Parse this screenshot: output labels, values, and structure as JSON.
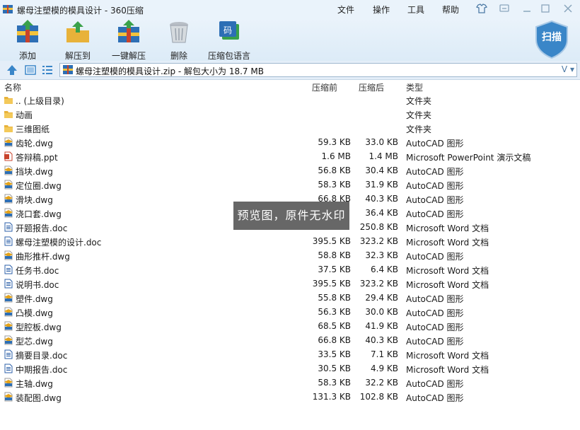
{
  "window": {
    "title": "螺母注塑模的模具设计 - 360压缩",
    "menus": [
      "文件",
      "操作",
      "工具",
      "帮助"
    ]
  },
  "toolbar": {
    "buttons": [
      {
        "label": "添加",
        "icon": "add-archive-icon"
      },
      {
        "label": "解压到",
        "icon": "extract-to-folder-icon"
      },
      {
        "label": "一键解压",
        "icon": "one-click-extract-icon"
      },
      {
        "label": "删除",
        "icon": "trash-can-icon"
      },
      {
        "label": "压缩包语言",
        "icon": "archive-language-icon"
      }
    ],
    "language_badge": "码",
    "scan_label": "扫描"
  },
  "address": {
    "path": "螺母注塑模的模具设计.zip - 解包大小为 18.7 MB",
    "dropdown_label": "V"
  },
  "columns": {
    "name": "名称",
    "size": "压缩前",
    "compressed": "压缩后",
    "type": "类型"
  },
  "files": [
    {
      "name": ".. (上级目录)",
      "size": "",
      "compressed": "",
      "type": "文件夹",
      "icon": "folder-icon"
    },
    {
      "name": "动画",
      "size": "",
      "compressed": "",
      "type": "文件夹",
      "icon": "folder-icon"
    },
    {
      "name": "三维图纸",
      "size": "",
      "compressed": "",
      "type": "文件夹",
      "icon": "folder-icon"
    },
    {
      "name": "齿轮.dwg",
      "size": "59.3 KB",
      "compressed": "33.0 KB",
      "type": "AutoCAD 图形",
      "icon": "dwg-file-icon"
    },
    {
      "name": "答辩稿.ppt",
      "size": "1.6 MB",
      "compressed": "1.4 MB",
      "type": "Microsoft PowerPoint 演示文稿",
      "icon": "ppt-file-icon"
    },
    {
      "name": "挡块.dwg",
      "size": "56.8 KB",
      "compressed": "30.4 KB",
      "type": "AutoCAD 图形",
      "icon": "dwg-file-icon"
    },
    {
      "name": "定位圈.dwg",
      "size": "58.3 KB",
      "compressed": "31.9 KB",
      "type": "AutoCAD 图形",
      "icon": "dwg-file-icon"
    },
    {
      "name": "滑块.dwg",
      "size": "66.8 KB",
      "compressed": "40.3 KB",
      "type": "AutoCAD 图形",
      "icon": "dwg-file-icon"
    },
    {
      "name": "浇口套.dwg",
      "size": "",
      "compressed": "36.4 KB",
      "type": "AutoCAD 图形",
      "icon": "dwg-file-icon"
    },
    {
      "name": "开题报告.doc",
      "size": "",
      "compressed": "250.8 KB",
      "type": "Microsoft Word 文档",
      "icon": "doc-file-icon"
    },
    {
      "name": "螺母注塑模的设计.doc",
      "size": "395.5 KB",
      "compressed": "323.2 KB",
      "type": "Microsoft Word 文档",
      "icon": "doc-file-icon"
    },
    {
      "name": "曲形推杆.dwg",
      "size": "58.8 KB",
      "compressed": "32.3 KB",
      "type": "AutoCAD 图形",
      "icon": "dwg-file-icon"
    },
    {
      "name": "任务书.doc",
      "size": "37.5 KB",
      "compressed": "6.4 KB",
      "type": "Microsoft Word 文档",
      "icon": "doc-file-icon"
    },
    {
      "name": "说明书.doc",
      "size": "395.5 KB",
      "compressed": "323.2 KB",
      "type": "Microsoft Word 文档",
      "icon": "doc-file-icon"
    },
    {
      "name": "塑件.dwg",
      "size": "55.8 KB",
      "compressed": "29.4 KB",
      "type": "AutoCAD 图形",
      "icon": "dwg-file-icon"
    },
    {
      "name": "凸模.dwg",
      "size": "56.3 KB",
      "compressed": "30.0 KB",
      "type": "AutoCAD 图形",
      "icon": "dwg-file-icon"
    },
    {
      "name": "型腔板.dwg",
      "size": "68.5 KB",
      "compressed": "41.9 KB",
      "type": "AutoCAD 图形",
      "icon": "dwg-file-icon"
    },
    {
      "name": "型芯.dwg",
      "size": "66.8 KB",
      "compressed": "40.3 KB",
      "type": "AutoCAD 图形",
      "icon": "dwg-file-icon"
    },
    {
      "name": "摘要目录.doc",
      "size": "33.5 KB",
      "compressed": "7.1 KB",
      "type": "Microsoft Word 文档",
      "icon": "doc-file-icon"
    },
    {
      "name": "中期报告.doc",
      "size": "30.5 KB",
      "compressed": "4.9 KB",
      "type": "Microsoft Word 文档",
      "icon": "doc-file-icon"
    },
    {
      "name": "主轴.dwg",
      "size": "58.3 KB",
      "compressed": "32.2 KB",
      "type": "AutoCAD 图形",
      "icon": "dwg-file-icon"
    },
    {
      "name": "装配图.dwg",
      "size": "131.3 KB",
      "compressed": "102.8 KB",
      "type": "AutoCAD 图形",
      "icon": "dwg-file-icon"
    }
  ],
  "watermark": "预览图，原件无水印",
  "colors": {
    "folder": "#e8b23a",
    "dwg": "#e3a21a",
    "doc": "#2b5fa8",
    "ppt": "#c8432c",
    "accent": "#2d6fb5",
    "scan_shield": "#3a86c8"
  }
}
